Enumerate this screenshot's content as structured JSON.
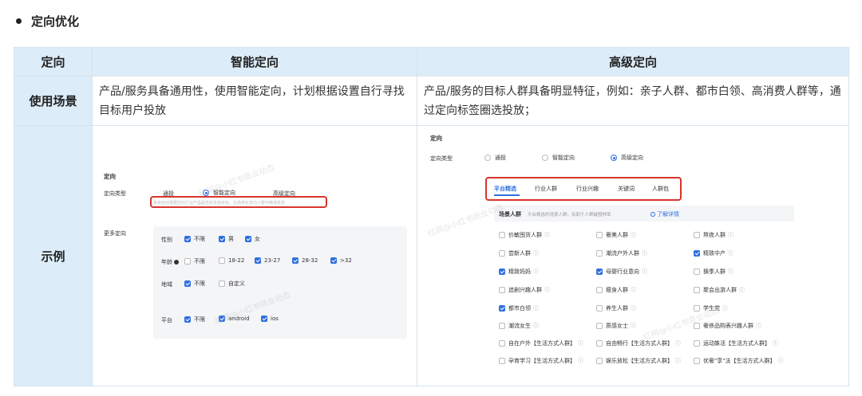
{
  "section": {
    "title": "定向优化"
  },
  "table": {
    "headers": [
      "定向",
      "智能定向",
      "高级定向"
    ],
    "usage_label": "使用场景",
    "usage_smart": "产品/服务具备通用性，使用智能定向，计划根据设置自行寻找目标用户投放",
    "usage_advanced": "产品/服务的目标人群具备明显特征，例如：亲子人群、都市白领、高消费人群等，通过定向标签圈选投放；",
    "example_label": "示例"
  },
  "left_shot": {
    "title": "定向",
    "type_label": "定向类型",
    "opt_general": "通投",
    "opt_smart": "智能定向",
    "opt_advanced": "高级定向",
    "hint": "系统自动根据您的行业产品属性和投放目标，在高转化意向人群中精准投放",
    "more_label": "更多定向",
    "gender": {
      "label": "性别",
      "opts": [
        "不限",
        "男",
        "女"
      ]
    },
    "age": {
      "label": "年龄",
      "opts": [
        "不限",
        "18-22",
        "23-27",
        "28-32",
        ">32"
      ]
    },
    "region": {
      "label": "地域",
      "opts": [
        "不限",
        "自定义"
      ]
    },
    "platform": {
      "label": "平台",
      "opts": [
        "不限",
        "android",
        "ios"
      ]
    }
  },
  "right_shot": {
    "title": "定向",
    "type_label": "定向类型",
    "opt_general": "通投",
    "opt_smart": "智能定向",
    "opt_advanced": "高级定向",
    "tabs": [
      "平台精选",
      "行业人群",
      "行业兴趣",
      "关键词",
      "人群包"
    ],
    "scene_label": "场景人群",
    "scene_desc": "平台精选的场景人群，有助于人群破圈种草",
    "learn_more": "了解详情",
    "groups": [
      [
        "价敏囤货人群",
        "奢美人群",
        "熬夜人群"
      ],
      [
        "尝新人群",
        "潮流户外人群",
        "精致中产"
      ],
      [
        "精致妈妈",
        "母婴行业意向",
        "换季人群"
      ],
      [
        "追剧兴趣人群",
        "瘦身人群",
        "聚会出游人群"
      ],
      [
        "都市白领",
        "养生人群",
        "学生党"
      ],
      [
        "潮流女生",
        "质感女士",
        "奢侈品购表兴趣人群"
      ],
      [
        "自在户外【生活方式人群】",
        "自由畅行【生活方式人群】",
        "运动姝活【生活方式人群】"
      ],
      [
        "孕育学习【生活方式人群】",
        "娱乐放松【生活方式人群】",
        "优奢\"享\"法【生活方式人群】"
      ]
    ]
  },
  "watermark": "红网@小红书商业动态"
}
